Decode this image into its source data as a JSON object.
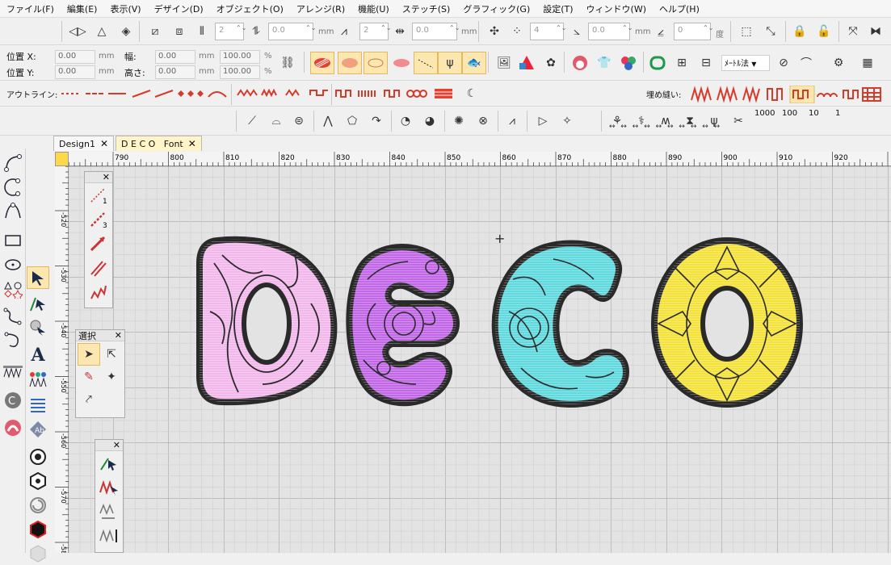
{
  "menu": [
    "ファイル(F)",
    "編集(E)",
    "表示(V)",
    "デザイン(D)",
    "オブジェクト(O)",
    "アレンジ(R)",
    "機能(U)",
    "ステッチ(S)",
    "グラフィック(G)",
    "設定(T)",
    "ウィンドウ(W)",
    "ヘルプ(H)"
  ],
  "toolbar1": {
    "spin1": "2",
    "spin2": "0.0",
    "unit_mm1": "mm",
    "spin3": "2",
    "spin4": "0.0",
    "unit_mm2": "mm",
    "spin5": "4",
    "spin6": "0.0",
    "unit_mm3": "mm",
    "spin7": "0",
    "unit_deg": "度"
  },
  "position": {
    "x_label": "位置 X:",
    "y_label": "位置 Y:",
    "x": "0.00",
    "y": "0.00",
    "x_unit": "mm",
    "y_unit": "mm",
    "w_label": "幅:",
    "h_label": "高さ:",
    "w": "0.00",
    "h": "0.00",
    "w_unit": "mm",
    "h_unit": "mm",
    "w_pct": "100.00",
    "h_pct": "100.00",
    "pct": "%"
  },
  "measure_select": "ﾒｰﾄﾙ法",
  "outline_label": "アウトライン:",
  "fill_label": "埋め縫い:",
  "stitch_counts": [
    "1000",
    "100",
    "10",
    "1"
  ],
  "tabs": [
    {
      "label": "Design1"
    },
    {
      "label": "D E C O   Font"
    }
  ],
  "select_palette_title": "選択",
  "palette_close": "✕",
  "ruler_h": [
    {
      "v": "790"
    },
    {
      "v": "800"
    },
    {
      "v": "810"
    },
    {
      "v": "820"
    },
    {
      "v": "830"
    },
    {
      "v": "840"
    },
    {
      "v": "850"
    },
    {
      "v": "860"
    },
    {
      "v": "870"
    },
    {
      "v": "880"
    },
    {
      "v": "890"
    },
    {
      "v": "900"
    },
    {
      "v": "910"
    },
    {
      "v": "920"
    }
  ],
  "ruler_v": [
    {
      "v": "-520"
    },
    {
      "v": "-530"
    },
    {
      "v": "-540"
    },
    {
      "v": "-550"
    },
    {
      "v": "-560"
    },
    {
      "v": "-570"
    },
    {
      "v": "-580"
    }
  ],
  "letters": [
    {
      "ch": "D",
      "color": "#f2b8ec"
    },
    {
      "ch": "E",
      "color": "#c267e8"
    },
    {
      "ch": "C",
      "color": "#5fd9dd"
    },
    {
      "ch": "O",
      "color": "#f4e23a"
    }
  ],
  "colors": {
    "accent": "#d63a2a",
    "highlight": "#fde7b0",
    "tab_active": "#fff5c8"
  }
}
